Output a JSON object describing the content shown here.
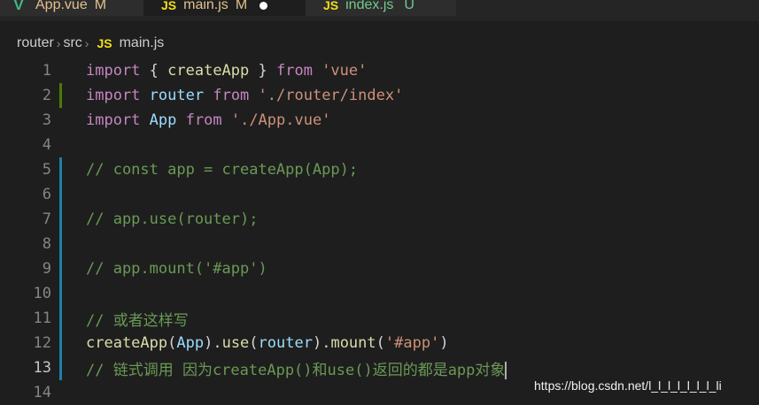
{
  "tabs": [
    {
      "icon": "V",
      "name": "App.vue",
      "status": "M"
    },
    {
      "icon": "JS",
      "name": "main.js",
      "status": "M"
    },
    {
      "icon": "JS",
      "name": "index.js",
      "status": "U"
    }
  ],
  "breadcrumb": {
    "items": [
      "router",
      "src"
    ],
    "file_icon": "JS",
    "file": "main.js"
  },
  "lines": {
    "n1": "1",
    "n2": "2",
    "n3": "3",
    "n4": "4",
    "n5": "5",
    "n6": "6",
    "n7": "7",
    "n8": "8",
    "n9": "9",
    "n10": "10",
    "n11": "11",
    "n12": "12",
    "n13": "13",
    "n14": "14"
  },
  "code": {
    "l1": {
      "import": "import",
      "open": " { ",
      "fn": "createApp",
      "close": " } ",
      "from": "from",
      "space": " ",
      "str": "'vue'"
    },
    "l2": {
      "import": "import",
      "space1": " ",
      "var": "router",
      "space2": " ",
      "from": "from",
      "space3": " ",
      "str": "'./router/index'"
    },
    "l3": {
      "import": "import",
      "space1": " ",
      "var": "App",
      "space2": " ",
      "from": "from",
      "space3": " ",
      "str": "'./App.vue'"
    },
    "l5": "// const app = createApp(App);",
    "l7": "// app.use(router);",
    "l9": "// app.mount('#app')",
    "l11": "// 或者这样写",
    "l12": {
      "fn1": "createApp",
      "p1": "(",
      "arg1": "App",
      "p2": ").",
      "fn2": "use",
      "p3": "(",
      "arg2": "router",
      "p4": ").",
      "fn3": "mount",
      "p5": "(",
      "str": "'#app'",
      "p6": ")"
    },
    "l13": "// 链式调用 因为createApp()和use()返回的都是app对象"
  },
  "watermark": "https://blog.csdn.net/l_l_l_l_l_l_l_li",
  "colors": {
    "background": "#1e1e1e",
    "keyword": "#c586c0",
    "function": "#dcdcaa",
    "variable": "#9cdcfe",
    "string": "#ce9178",
    "comment": "#6a9955",
    "modified": "#e2c08d",
    "untracked": "#73c991"
  }
}
